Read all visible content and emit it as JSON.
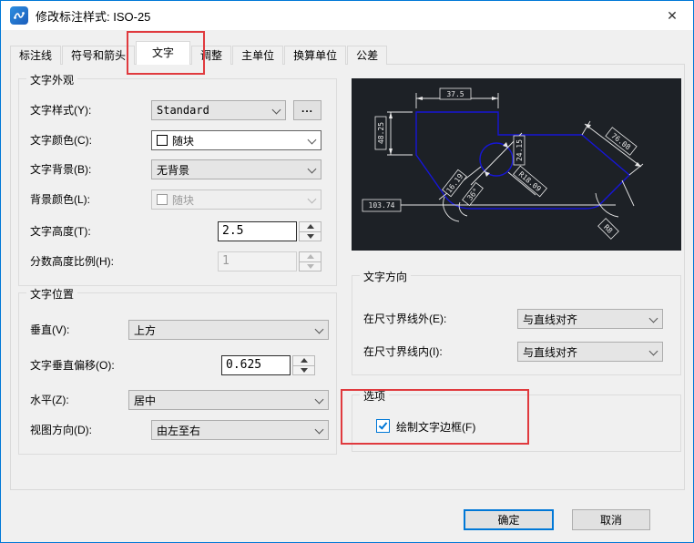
{
  "window": {
    "title": "修改标注样式: ISO-25"
  },
  "icons": {
    "close": "✕",
    "ellipsis": "..."
  },
  "tabs": {
    "items": [
      {
        "label": "标注线"
      },
      {
        "label": "符号和箭头"
      },
      {
        "label": "文字"
      },
      {
        "label": "调整"
      },
      {
        "label": "主单位"
      },
      {
        "label": "换算单位"
      },
      {
        "label": "公差"
      }
    ],
    "selected": "文字"
  },
  "appearance": {
    "title": "文字外观",
    "style_label": "文字样式(Y):",
    "style_value": "Standard",
    "color_label": "文字颜色(C):",
    "color_value": "随块",
    "fill_label": "文字背景(B):",
    "fill_value": "无背景",
    "fill_color_label": "背景颜色(L):",
    "fill_color_value": "随块",
    "height_label": "文字高度(T):",
    "height_value": "2.5",
    "fraction_label": "分数高度比例(H):",
    "fraction_value": "1"
  },
  "placement": {
    "title": "文字位置",
    "vertical_label": "垂直(V):",
    "vertical_value": "上方",
    "offset_label": "文字垂直偏移(O):",
    "offset_value": "0.625",
    "horizontal_label": "水平(Z):",
    "horizontal_value": "居中",
    "view_label": "视图方向(D):",
    "view_value": "由左至右"
  },
  "alignment": {
    "title": "文字方向",
    "outside_label": "在尺寸界线外(E):",
    "outside_value": "与直线对齐",
    "inside_label": "在尺寸界线内(I):",
    "inside_value": "与直线对齐"
  },
  "options": {
    "title": "选项",
    "frame_label": "绘制文字边框(F)",
    "frame_checked": true
  },
  "preview": {
    "labels": {
      "top": "37.5",
      "left": "48.25",
      "diameter": "24.15",
      "radius": "R18.09",
      "baseline": "103.74",
      "slant": "76.08",
      "angle_a": "16.19",
      "angle_b": "36°",
      "corner": "R8"
    }
  },
  "footer": {
    "ok": "确定",
    "cancel": "取消"
  },
  "colors": {
    "accent": "#0078d7",
    "annotation": "#e03a3e",
    "preview_background": "#1d2126",
    "preview_geometry": "#1616d6",
    "preview_dimensions": "#e8e8e8"
  }
}
